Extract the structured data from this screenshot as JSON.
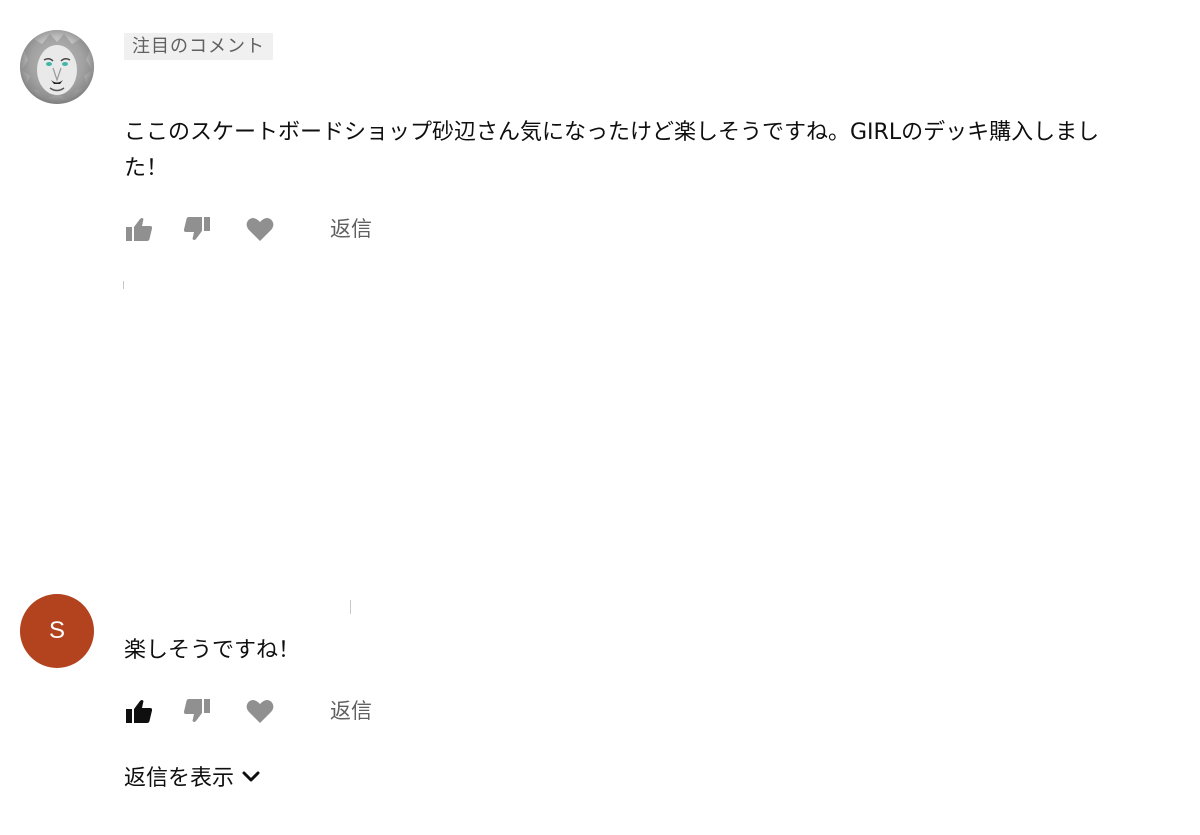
{
  "comments": [
    {
      "avatar": {
        "kind": "image",
        "icon": "lion-face-avatar-icon"
      },
      "badge": "注目のコメント",
      "text": "ここのスケートボードショップ砂辺さん気になったけど楽しそうですね。GIRLのデッキ購入しました！",
      "actions": {
        "like_icon": "thumbs-up-outline-icon",
        "dislike_icon": "thumbs-down-icon",
        "heart_icon": "heart-icon",
        "reply_label": "返信"
      }
    },
    {
      "avatar": {
        "kind": "letter",
        "letter": "S",
        "color": "#b3421f"
      },
      "text": "楽しそうですね！",
      "actions": {
        "like_icon": "thumbs-up-filled-icon",
        "dislike_icon": "thumbs-down-icon",
        "heart_icon": "heart-icon",
        "reply_label": "返信"
      },
      "show_replies_label": "返信を表示"
    }
  ],
  "colors": {
    "icon_gray": "#909090",
    "icon_active": "#0f0f0f",
    "text_secondary": "#606060",
    "badge_bg": "#f0f0f0"
  }
}
